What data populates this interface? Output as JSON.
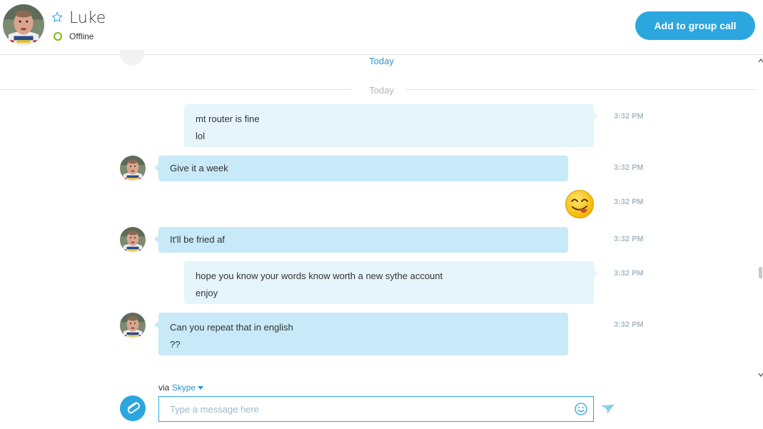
{
  "header": {
    "contact_name": "Luke",
    "status": "Offline",
    "call_button_label": "Add to group call"
  },
  "conversation": {
    "sticky_day_label": "Today",
    "divider_label": "Today",
    "messages": [
      {
        "direction": "sent",
        "lines": [
          "mt router is fine",
          "lol"
        ],
        "time": "3:32 PM"
      },
      {
        "direction": "received",
        "lines": [
          "Give it a week"
        ],
        "time": "3:32 PM"
      },
      {
        "direction": "sent",
        "emoji": "yum-emoji",
        "time": "3:32 PM"
      },
      {
        "direction": "received",
        "lines": [
          "It'll be fried af"
        ],
        "time": "3:32 PM"
      },
      {
        "direction": "sent",
        "lines": [
          "hope you know your words know worth a new sythe account",
          "enjoy"
        ],
        "time": "3:32 PM"
      },
      {
        "direction": "received",
        "lines": [
          "Can you repeat that in english",
          "??"
        ],
        "time": "3:32 PM"
      }
    ]
  },
  "composer": {
    "via_prefix": "via",
    "via_service": "Skype",
    "placeholder": "Type a message here"
  },
  "colors": {
    "accent": "#2ca6de",
    "sent_bubble": "#e6f4fb",
    "received_bubble": "#c7e9f8",
    "timestamp": "#a9bac7",
    "online_status": "#7fba00"
  }
}
